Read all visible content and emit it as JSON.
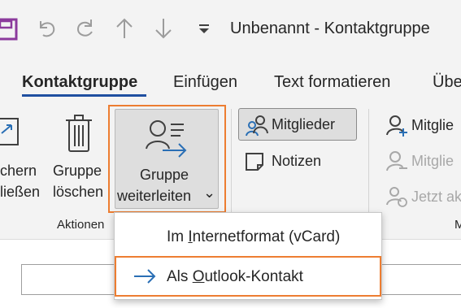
{
  "title": "Unbenannt  -  Kontaktgruppe",
  "quick_access": {
    "save_icon": "save-icon",
    "undo_icon": "undo-icon",
    "redo_icon": "redo-icon",
    "up_icon": "arrow-up-icon",
    "down_icon": "arrow-down-icon",
    "customize_icon": "customize-quick-access-icon"
  },
  "tabs": [
    {
      "label": "Kontaktgruppe",
      "active": true
    },
    {
      "label": "Einfügen"
    },
    {
      "label": "Text formatieren"
    },
    {
      "label": "Übe"
    }
  ],
  "ribbon": {
    "close_line1": "chern",
    "close_line2": "ließen",
    "delete_line1": "Gruppe",
    "delete_line2": "löschen",
    "forward_line1": "Gruppe",
    "forward_line2": "weiterleiten",
    "forward_chevron": "⌄",
    "actions_group_label": "Aktionen",
    "members_label": "Mitglieder",
    "notes_label": "Notizen",
    "add_members_label": "Mitglie",
    "remove_members_label": "Mitglie",
    "update_now_label": "Jetzt ak",
    "members_group_label_partial": "M"
  },
  "dropdown": {
    "items": [
      {
        "label_prefix": "Im ",
        "label_accel": "I",
        "label_rest": "nternetformat (vCard)"
      },
      {
        "label_prefix": "Als ",
        "label_accel": "O",
        "label_rest": "utlook-Kontakt",
        "highlighted": true
      }
    ]
  },
  "colors": {
    "accent_orange": "#ed7d31",
    "save_purple": "#8b3a9c",
    "active_tab_underline": "#1f4fa0",
    "icon_blue": "#2a6fb5"
  }
}
